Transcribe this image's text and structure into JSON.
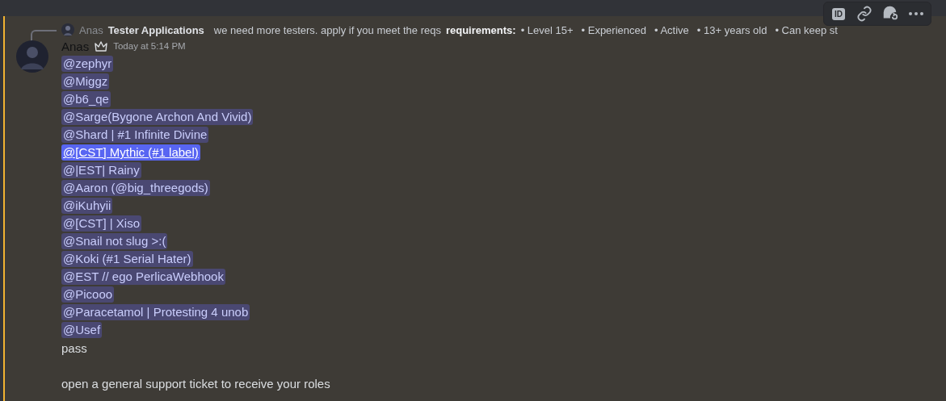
{
  "reply": {
    "author": "Anas",
    "title": "Tester Applications",
    "text": "we need more testers. apply if you meet the reqs",
    "label": "requirements:",
    "items": [
      "• Level 15+",
      "• Experienced",
      "• Active",
      "• 13+ years old",
      "• Can keep st"
    ]
  },
  "message": {
    "author": "Anas",
    "owner": true,
    "timestamp": "Today at 5:14 PM",
    "mentions": [
      {
        "text": "@zephyr",
        "selected": false
      },
      {
        "text": "@Miggz",
        "selected": false
      },
      {
        "text": "@b6_qe",
        "selected": false
      },
      {
        "text": "@Sarge(Bygone Archon And Vivid)",
        "selected": false
      },
      {
        "text": "@Shard | #1 Infinite Divine",
        "selected": false
      },
      {
        "text": "@[CST] Mythic (#1 label)",
        "selected": true
      },
      {
        "text": "@|EST| Rainy",
        "selected": false
      },
      {
        "text": "@Aaron (@big_threegods)",
        "selected": false
      },
      {
        "text": "@iKuhyii",
        "selected": false
      },
      {
        "text": "@[CST] | Xiso",
        "selected": false
      },
      {
        "text": "@Snail not slug >:(",
        "selected": false
      },
      {
        "text": "@Koki (#1 Serial Hater)",
        "selected": false
      },
      {
        "text": "@EST // ego PerlicaWebhook",
        "selected": false
      },
      {
        "text": "@Picooo",
        "selected": false
      },
      {
        "text": "@Paracetamol | Protesting 4 unob",
        "selected": false
      },
      {
        "text": "@Usef",
        "selected": false
      }
    ],
    "lines": [
      "pass",
      "open a general support ticket to receive your roles"
    ]
  },
  "toolbar": {
    "id_label": "ID"
  }
}
